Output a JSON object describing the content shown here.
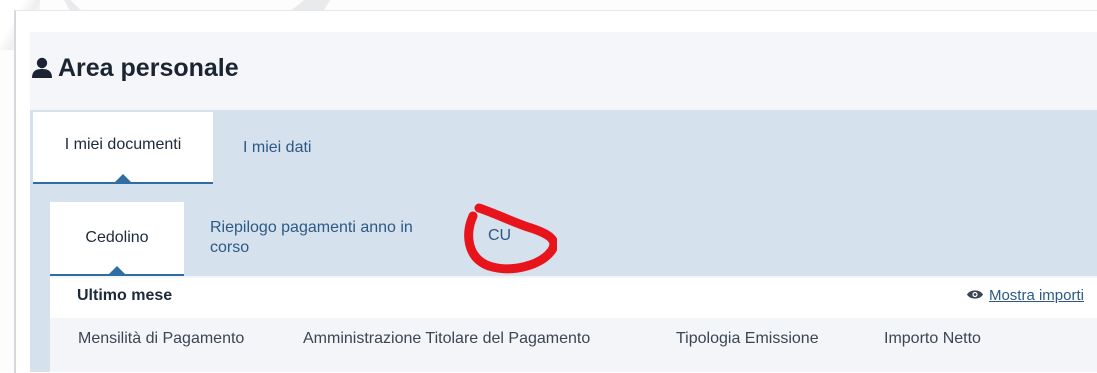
{
  "page": {
    "title": "Area personale",
    "title_icon": "user-icon"
  },
  "tabs": [
    {
      "label": "I miei documenti",
      "active": true
    },
    {
      "label": "I miei dati",
      "active": false
    }
  ],
  "subtabs": [
    {
      "label": "Cedolino",
      "active": true
    },
    {
      "label": "Riepilogo pagamenti anno in corso",
      "active": false
    },
    {
      "label": "CU",
      "active": false,
      "highlighted": true
    }
  ],
  "section": {
    "heading": "Ultimo mese",
    "toggle_label": "Mostra importi",
    "toggle_icon": "eye-icon"
  },
  "table": {
    "columns": [
      "Mensilità di Pagamento",
      "Amministrazione Titolare del Pagamento",
      "Tipologia Emissione",
      "Importo Netto"
    ]
  },
  "colors": {
    "tab_bar": "#d5e1ec",
    "accent": "#2f6ea3",
    "annotation": "#e8141c"
  }
}
